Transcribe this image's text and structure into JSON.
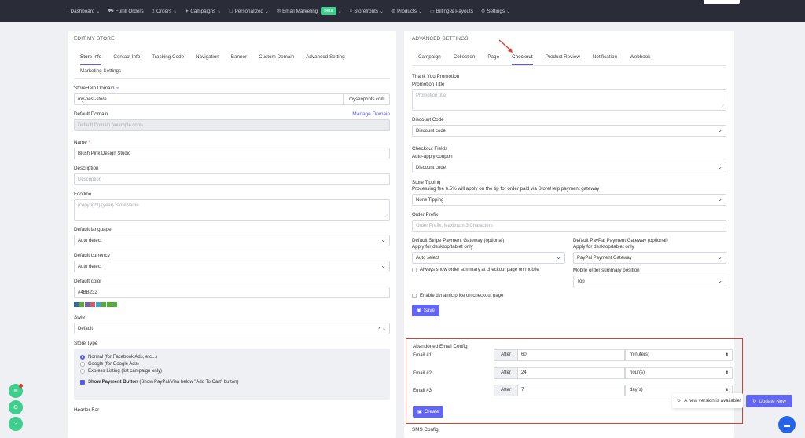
{
  "nav": {
    "items": [
      {
        "icon": "dashboard-icon",
        "glyph": "⫶",
        "label": "Dashboard",
        "caret": true
      },
      {
        "icon": "truck-icon",
        "glyph": "⛟",
        "label": "Fulfill Orders",
        "caret": false
      },
      {
        "icon": "cart-icon",
        "glyph": "⊻",
        "label": "Orders",
        "caret": true
      },
      {
        "icon": "campaign-icon",
        "glyph": "✦",
        "label": "Campaigns",
        "caret": true
      },
      {
        "icon": "personalized-icon",
        "glyph": "☐",
        "label": "Personalized",
        "caret": true
      },
      {
        "icon": "mail-icon",
        "glyph": "✉",
        "label": "Email Marketing",
        "caret": true,
        "badge": "Beta"
      },
      {
        "icon": "storefront-icon",
        "glyph": "⌂",
        "label": "Storefronts",
        "caret": true
      },
      {
        "icon": "products-icon",
        "glyph": "⊛",
        "label": "Products",
        "caret": true
      },
      {
        "icon": "billing-icon",
        "glyph": "▭",
        "label": "Billing & Payouts",
        "caret": false
      },
      {
        "icon": "settings-icon",
        "glyph": "⚙",
        "label": "Settings",
        "caret": true
      }
    ]
  },
  "left": {
    "title": "EDIT MY STORE",
    "tabs": [
      "Store Info",
      "Contact Info",
      "Tracking Code",
      "Navigation",
      "Banner",
      "Custom Domain",
      "Advanced Setting",
      "Marketing Settings"
    ],
    "storehelp_domain_label": "StoreHelp Domain",
    "storehelp_domain_value": "my-best-store",
    "storehelp_domain_suffix": ".mysenprints.com",
    "default_domain_label": "Default Domain",
    "manage_domain": "Manage Domain",
    "default_domain_placeholder": "Default Domain (example.com)",
    "name_label": "Name",
    "name_value": "Blush Pink Design Studio",
    "description_label": "Description",
    "description_placeholder": "Description",
    "footline_label": "Footline",
    "footline_placeholder": "{copyright} {year} StoreName",
    "language_label": "Default language",
    "language_value": "Auto detect",
    "currency_label": "Default currency",
    "currency_value": "Auto detect",
    "color_label": "Default color",
    "color_value": "#4BB232",
    "swatches": [
      "#2e6da4",
      "#4BB232",
      "#7b5ea7",
      "#e0556b",
      "#3ba6d3",
      "#4BB232",
      "#4BB232",
      "#4BB232"
    ],
    "style_label": "Style",
    "style_value": "Default",
    "store_type_label": "Store Type",
    "store_type_options": [
      {
        "label": "Normal (for Facebook Ads, etc...)",
        "selected": true
      },
      {
        "label": "Google (for Google Ads)",
        "selected": false
      },
      {
        "label": "Express Listing (list campaign only)",
        "selected": false
      }
    ],
    "show_payment_bold": "Show Payment Button",
    "show_payment_rest": " (Show PayPal/Visa below \"Add To Cart\" button)",
    "header_bar_label": "Header Bar"
  },
  "right": {
    "title": "ADVANCED SETTINGS",
    "tabs": [
      "Campaign",
      "Collection",
      "Page",
      "Checkout",
      "Product Review",
      "Notification",
      "Webhook"
    ],
    "active_tab": "Checkout",
    "thank_you": "Thank You Promotion",
    "promotion_title_label": "Promotion Title",
    "promotion_title_placeholder": "Promotion title",
    "discount_code_label": "Discount Code",
    "discount_code_value": "Discount code",
    "checkout_fields": "Checkout Fields",
    "auto_apply_label": "Auto-apply coupon",
    "auto_apply_value": "Discount code",
    "store_tipping": "Store Tipping",
    "tipping_note": "Processing fee 6.5% will apply on the tip for order paid via StoreHelp payment gateway",
    "tipping_value": "None Tipping",
    "order_prefix_label": "Order Prefix",
    "order_prefix_placeholder": "Order Prefix, Maximum 3 Characters",
    "stripe_label": "Default Stripe Payment Gateway (optional)",
    "stripe_note": "Apply for desktop/tablet only",
    "stripe_value": "Auto select",
    "paypal_label": "Default PayPal Payment Gateway (optional)",
    "paypal_note": "Apply for desktop/tablet only",
    "paypal_value": "PayPal Payment Gateway",
    "always_show": "Always show order summary at checkout page on mobile",
    "mobile_summary_label": "Mobile order summary position",
    "mobile_summary_value": "Top",
    "dynamic_price": "Enable dynamic price on checkout page",
    "save": "Save",
    "abandoned_title": "Abandoned Email Config",
    "emails": [
      {
        "label": "Email #1",
        "after": "After",
        "value": "60",
        "unit": "minute(s)"
      },
      {
        "label": "Email #2",
        "after": "After",
        "value": "24",
        "unit": "hour(s)"
      },
      {
        "label": "Email #3",
        "after": "After",
        "value": "7",
        "unit": "day(s)"
      }
    ],
    "create": "Create",
    "sms_config": "SMS Config"
  },
  "notification": {
    "text": "A new version is available!",
    "update_button": "Update Now"
  },
  "colors": {
    "accent": "#6366f1",
    "green": "#3ecf8e",
    "highlight_red": "#e23b2e",
    "nav_bg": "#2a2d38"
  }
}
